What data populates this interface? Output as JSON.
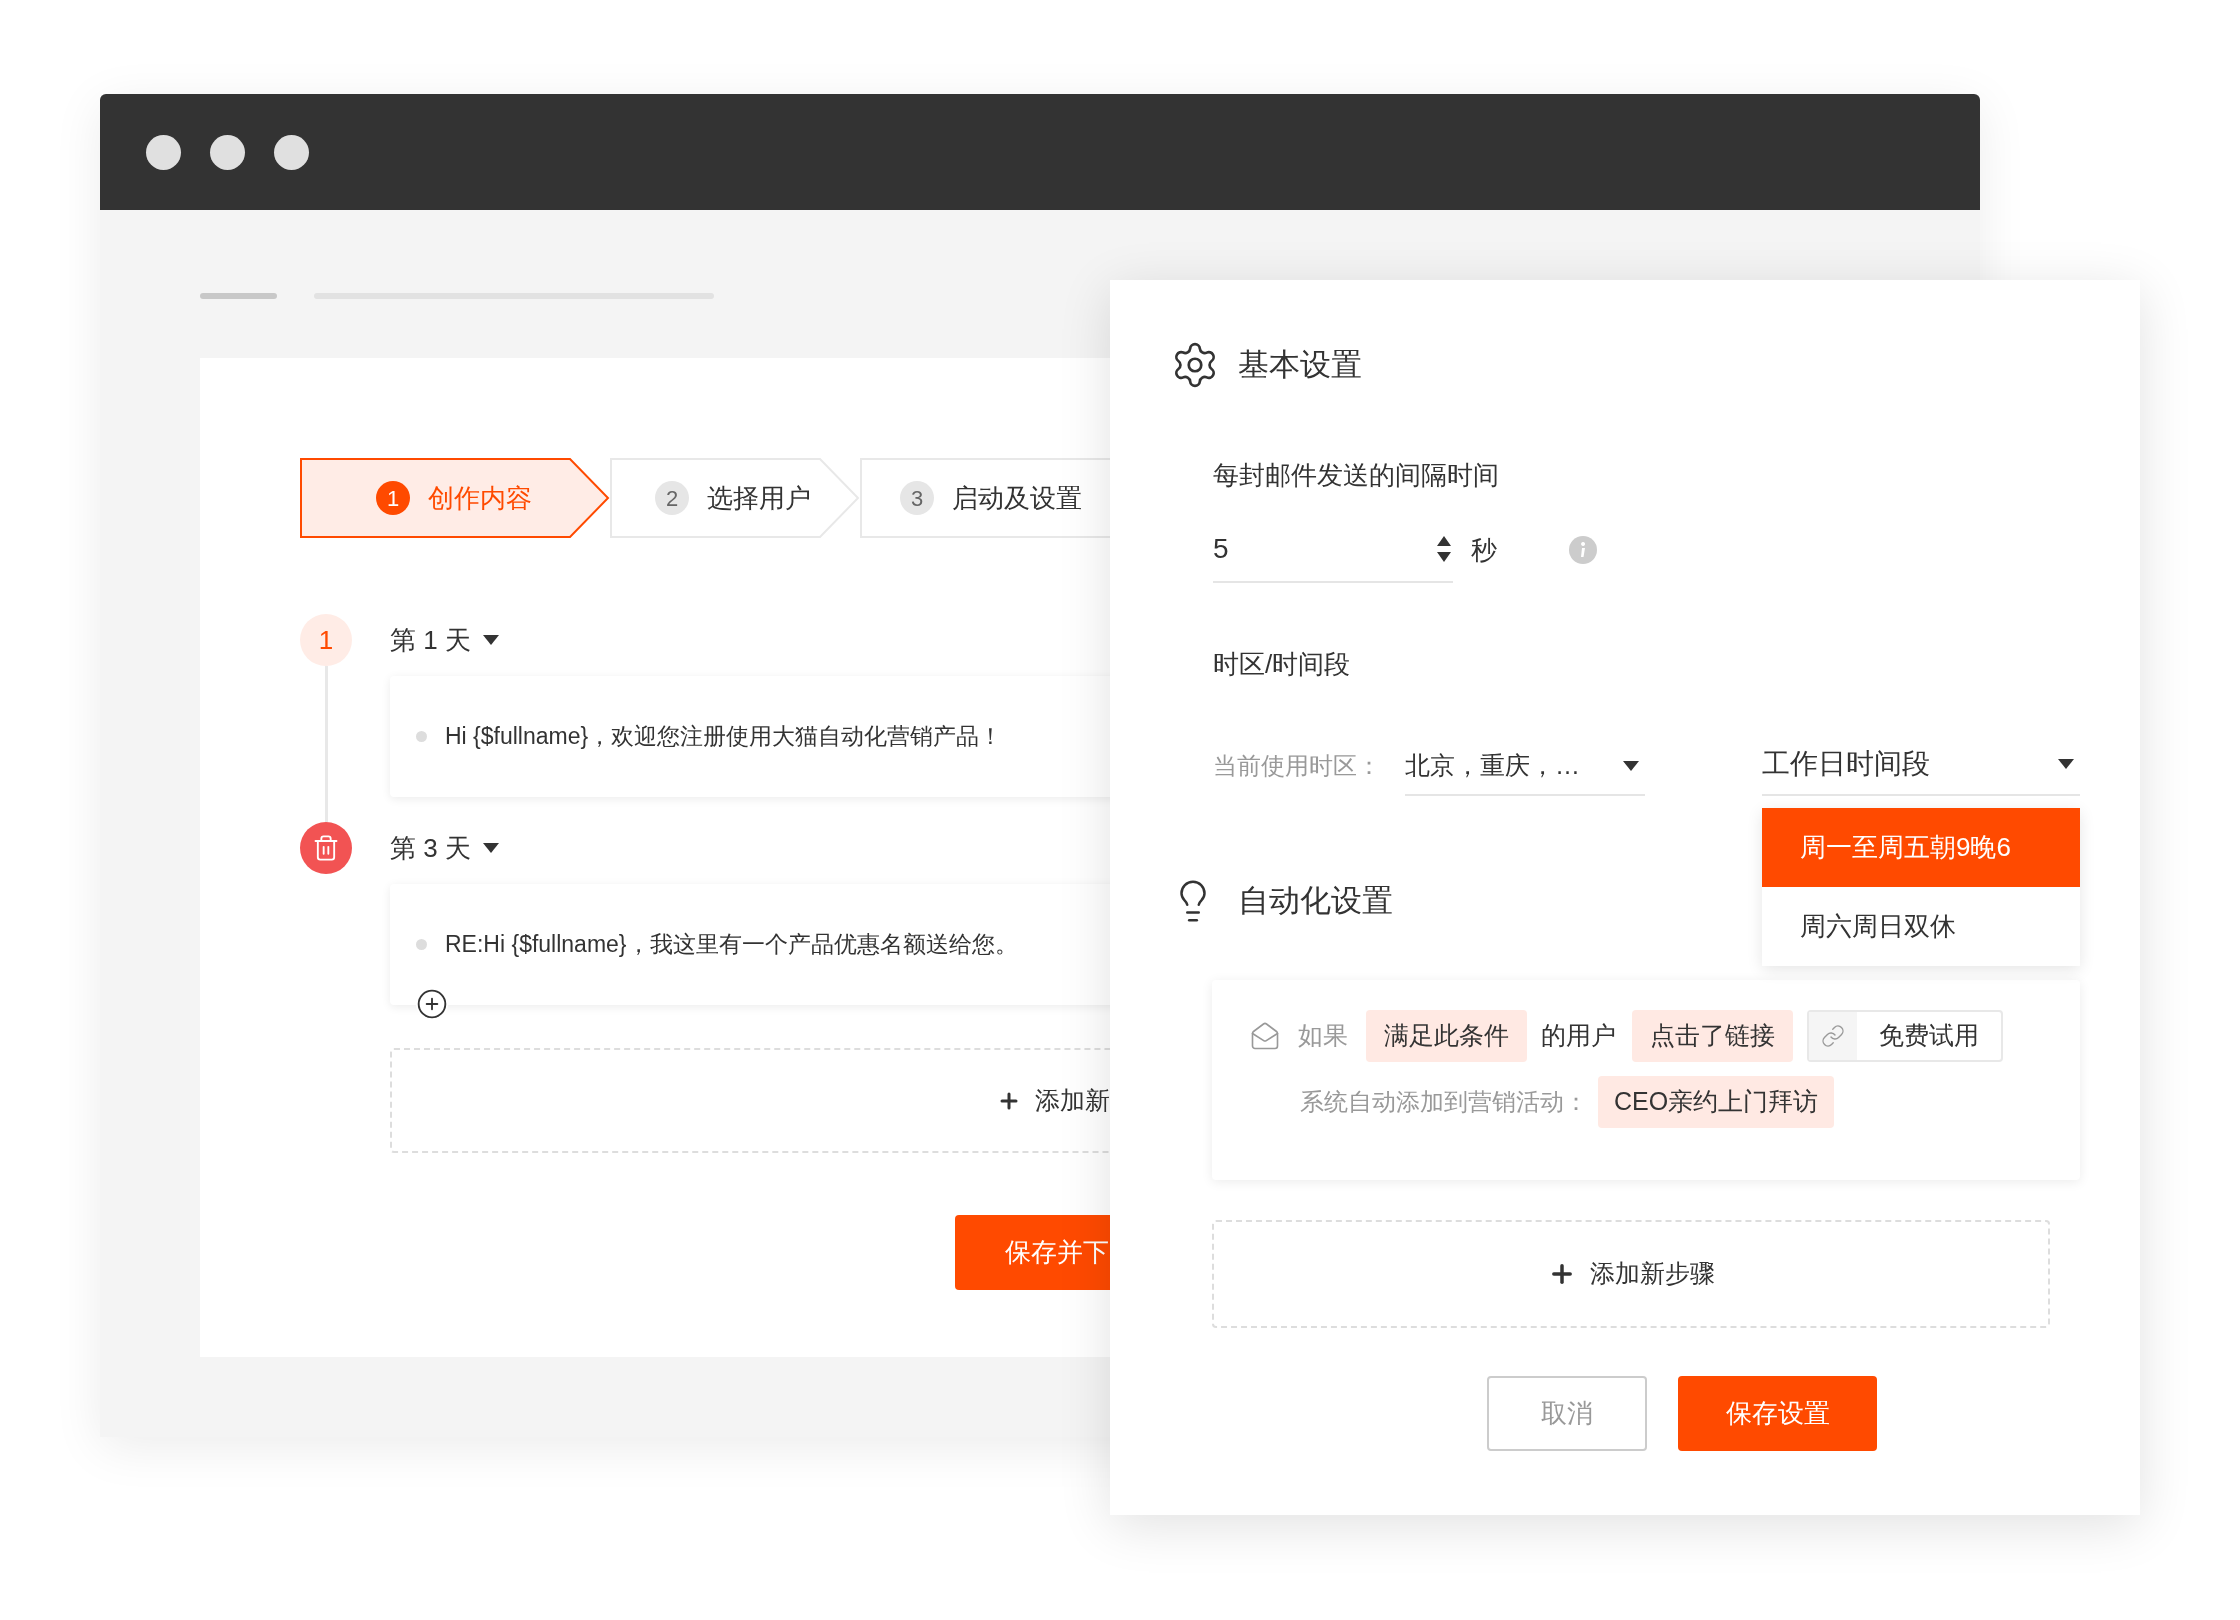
{
  "steps": [
    {
      "number": "1",
      "label": "创作内容",
      "selected": true
    },
    {
      "number": "2",
      "label": "选择用户",
      "selected": false
    },
    {
      "number": "3",
      "label": "启动及设置",
      "selected": false
    }
  ],
  "timeline": [
    {
      "marker": {
        "kind": "number",
        "text": "1"
      },
      "day": "第 1 天",
      "message": "Hi {$fullname}，欢迎您注册使用大猫自动化营销产品！",
      "add_button": false
    },
    {
      "marker": {
        "kind": "delete"
      },
      "day": "第 3 天",
      "message": "RE:Hi {$fullname}，我这里有一个产品优惠名额送给您。",
      "add_button": true
    }
  ],
  "add_step": "添加新",
  "save_button": "保存并下",
  "settings_panel": {
    "basic": {
      "title": "基本设置",
      "interval_label": "每封邮件发送的间隔时间",
      "interval_value": "5",
      "interval_unit": "秒",
      "timezone_label": "时区/时间段",
      "current_timezone_label": "当前使用时区：",
      "current_timezone_value": "北京，重庆，…",
      "period_select": "工作日时间段",
      "period_options": [
        {
          "label": "周一至周五朝9晚6",
          "selected": true
        },
        {
          "label": "周六周日双休",
          "selected": false
        }
      ]
    },
    "automation": {
      "title": "自动化设置",
      "if": "如果",
      "condition": "满足此条件",
      "of_users": "的用户",
      "action": "点击了链接",
      "link_value": "免费试用",
      "add_to_label": "系统自动添加到营销活动：",
      "campaign": "CEO亲约上门拜访"
    },
    "add_step": "添加新步骤",
    "buttons": [
      {
        "label": "取消",
        "kind": "secondary"
      },
      {
        "label": "保存设置",
        "kind": "primary"
      }
    ]
  }
}
